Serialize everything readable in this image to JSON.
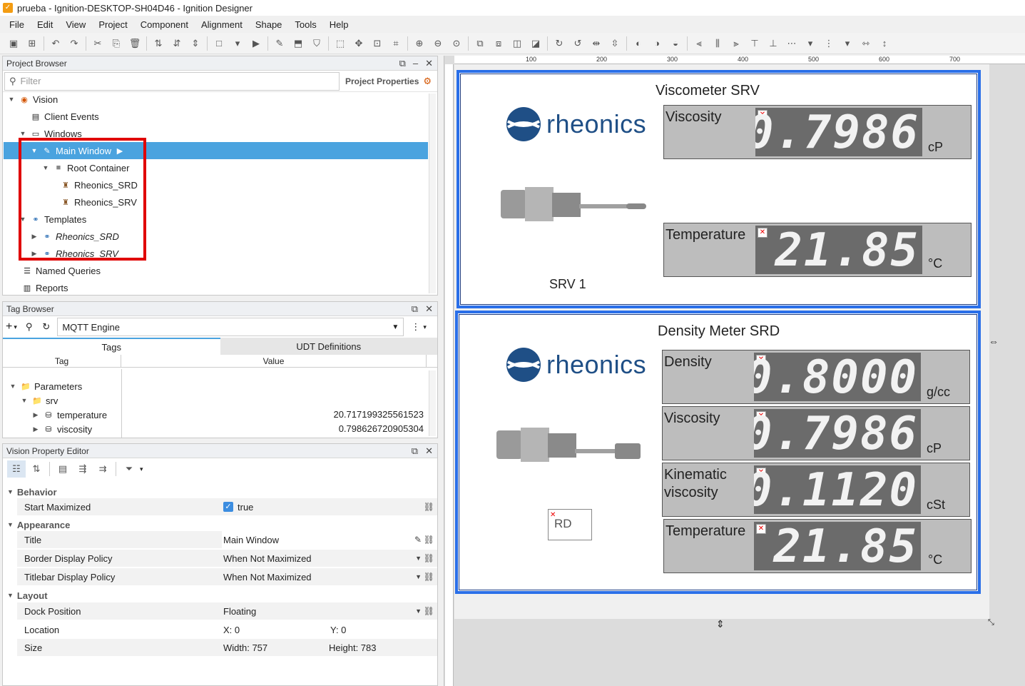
{
  "window": {
    "title": "prueba - Ignition-DESKTOP-SH04D46 - Ignition Designer"
  },
  "menu": [
    "File",
    "Edit",
    "View",
    "Project",
    "Component",
    "Alignment",
    "Shape",
    "Tools",
    "Help"
  ],
  "project_browser": {
    "title": "Project Browser",
    "filter_placeholder": "Filter",
    "properties_label": "Project Properties",
    "tree": {
      "vision": "Vision",
      "client_events": "Client Events",
      "windows": "Windows",
      "main_window": "Main Window",
      "root_container": "Root Container",
      "rheonics_srd": "Rheonics_SRD",
      "rheonics_srv": "Rheonics_SRV",
      "templates": "Templates",
      "tpl_srd": "Rheonics_SRD",
      "tpl_srv": "Rheonics_SRV",
      "named_queries": "Named Queries",
      "reports": "Reports"
    }
  },
  "tag_browser": {
    "title": "Tag Browser",
    "provider": "MQTT Engine",
    "tabs": [
      "Tags",
      "UDT Definitions"
    ],
    "columns": [
      "Tag",
      "Value"
    ],
    "rows": [
      {
        "name": "Parameters",
        "value": ""
      },
      {
        "name": "srv",
        "value": ""
      },
      {
        "name": "temperature",
        "value": "20.717199325561523"
      },
      {
        "name": "viscosity",
        "value": "0.798626720905304"
      }
    ]
  },
  "property_editor": {
    "title": "Vision Property Editor",
    "sections": {
      "behavior": "Behavior",
      "appearance": "Appearance",
      "layout": "Layout"
    },
    "props": {
      "start_maximized": {
        "name": "Start Maximized",
        "value": "true"
      },
      "title": {
        "name": "Title",
        "value": "Main Window"
      },
      "border_policy": {
        "name": "Border Display Policy",
        "value": "When Not Maximized"
      },
      "titlebar_policy": {
        "name": "Titlebar Display Policy",
        "value": "When Not Maximized"
      },
      "dock_position": {
        "name": "Dock Position",
        "value": "Floating"
      },
      "location": {
        "name": "Location",
        "x": "X: 0",
        "y": "Y: 0"
      },
      "size": {
        "name": "Size",
        "w": "Width: 757",
        "h": "Height: 783"
      }
    }
  },
  "rulers": [
    "100",
    "200",
    "300",
    "400",
    "500",
    "600",
    "700"
  ],
  "srv": {
    "title": "Viscometer SRV",
    "logo": "rheonics",
    "caption": "SRV 1",
    "meters": [
      {
        "label": "Viscosity",
        "value": "0.7986",
        "unit": "cP"
      },
      {
        "label": "Temperature",
        "value": "21.85",
        "unit": "°C"
      }
    ]
  },
  "srd": {
    "title": "Density Meter SRD",
    "logo": "rheonics",
    "caption": "RD",
    "meters": [
      {
        "label": "Density",
        "value": "0.8000",
        "unit": "g/cc"
      },
      {
        "label": "Viscosity",
        "value": "0.7986",
        "unit": "cP"
      },
      {
        "label": "Kinematic viscosity",
        "value": "0.1120",
        "unit": "cSt"
      },
      {
        "label": "Temperature",
        "value": "21.85",
        "unit": "°C"
      }
    ]
  },
  "colors": {
    "accent": "#4aa3df",
    "highlight_box": "#e00000",
    "template_border": "#2a6fe8",
    "lcd_bg": "#6b6b6b"
  }
}
